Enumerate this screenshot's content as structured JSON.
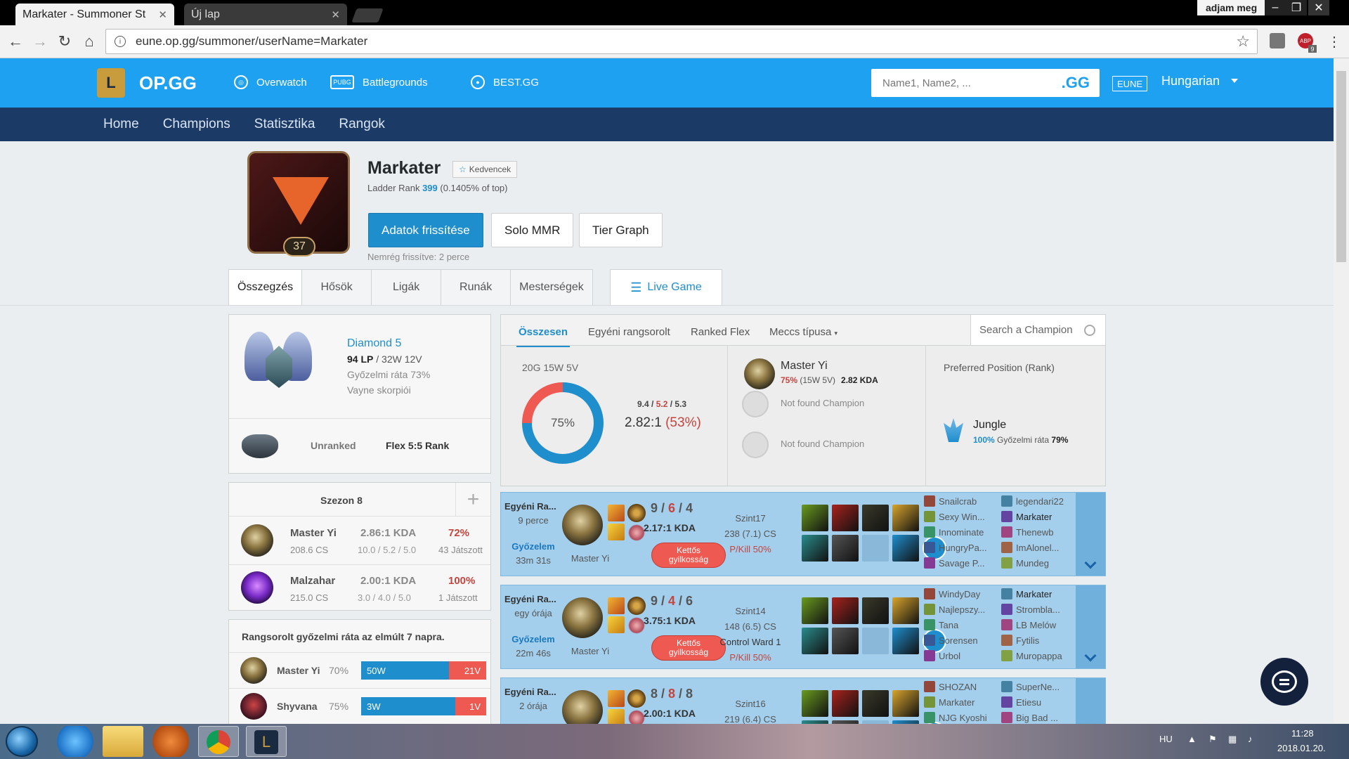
{
  "browser": {
    "tab_active": "Markater - Summoner St",
    "tab_inactive": "Új lap",
    "tab_favicon": "OP.GG",
    "user": "adjam meg",
    "url": "eune.op.gg/summoner/userName=Markater",
    "abp_label": "ABP",
    "abp_count": "9"
  },
  "header": {
    "brand": "OP.GG",
    "nav": [
      "Overwatch",
      "Battlegrounds",
      "BEST.GG"
    ],
    "search_placeholder": "Name1, Name2, ...",
    "search_suffix": ".GG",
    "region": "EUNE",
    "language": "Hungarian"
  },
  "subnav": [
    "Home",
    "Champions",
    "Statisztika",
    "Rangok"
  ],
  "profile": {
    "name": "Markater",
    "level": "37",
    "favorite": "Kedvencek",
    "ladder_prefix": "Ladder Rank ",
    "ladder_rank": "399",
    "ladder_suffix": " (0.1405% of top)",
    "btn_update": "Adatok frissítése",
    "btn_mmr": "Solo MMR",
    "btn_tier": "Tier Graph",
    "updated": "Nemrég frissítve: 2 perce"
  },
  "tabs": [
    "Összegzés",
    "Hősök",
    "Ligák",
    "Runák",
    "Mesterségek"
  ],
  "live_game": "Live Game",
  "rank": {
    "tier": "Diamond 5",
    "lp": "94 LP",
    "record": " / 32W 12V",
    "winrate": "Győzelmi ráta 73%",
    "league": "Vayne skorpiói",
    "flex_status": "Unranked",
    "flex_label": "Flex 5:5 Rank"
  },
  "season": {
    "title": "Szezon 8",
    "rows": [
      {
        "name": "Master Yi",
        "cs": "208.6 CS",
        "kda": "2.86:1 KDA",
        "kda3": "10.0 / 5.2 / 5.0",
        "pct": "72%",
        "games": "43 Játszott"
      },
      {
        "name": "Malzahar",
        "cs": "215.0 CS",
        "kda": "2.00:1 KDA",
        "kda3": "3.0 / 4.0 / 5.0",
        "pct": "100%",
        "games": "1 Játszott"
      }
    ]
  },
  "week": {
    "title": "Rangsorolt győzelmi ráta az elmúlt 7 napra.",
    "rows": [
      {
        "name": "Master Yi",
        "pct": "70%",
        "w": "50W",
        "l": "21V",
        "wfrac": 0.7
      },
      {
        "name": "Shyvana",
        "pct": "75%",
        "w": "3W",
        "l": "1V",
        "wfrac": 0.75
      }
    ]
  },
  "summary": {
    "tabs": [
      "Összesen",
      "Egyéni rangsorolt",
      "Ranked Flex",
      "Meccs típusa"
    ],
    "search": "Search a Champion",
    "games": "20G 15W 5V",
    "winrate_label": "75%",
    "winrate": 0.75,
    "k": "9.4",
    "d": "5.2",
    "a": "5.3",
    "ratio": "2.82:1",
    "ratio_pct": "(53%)",
    "top_champ": {
      "name": "Master Yi",
      "pct": "75%",
      "record": " (15W 5V)",
      "kda": "2.82 KDA"
    },
    "not_found": [
      "Not found Champion",
      "Not found Champion"
    ],
    "pref_title": "Preferred Position (Rank)",
    "position": "Jungle",
    "position_pct": "100%",
    "position_wr_label": "Győzelmi ráta",
    "position_wr": "79%"
  },
  "matches": [
    {
      "type": "Egyéni Ra...",
      "ago": "9 perce",
      "result": "Győzelem",
      "duration": "33m 31s",
      "champ": "Master Yi",
      "k": "9",
      "d": "6",
      "a": "4",
      "ratio": "2.17:1 KDA",
      "badge": [
        "Kettős",
        "gyilkosság"
      ],
      "level": "Szint17",
      "cs": "238 (7.1) CS",
      "ward": "",
      "pkill": "P/Kill 50%",
      "team1": [
        "Snailcrab",
        "Sexy Win...",
        "Innominate",
        "HungryPa...",
        "Savage P..."
      ],
      "team2": [
        "legendari22",
        "Markater",
        "Thenewb",
        "ImAlonel...",
        "Mundeg"
      ]
    },
    {
      "type": "Egyéni Ra...",
      "ago": "egy órája",
      "result": "Győzelem",
      "duration": "22m 46s",
      "champ": "Master Yi",
      "k": "9",
      "d": "4",
      "a": "6",
      "ratio": "3.75:1 KDA",
      "badge": [
        "Kettős",
        "gyilkosság"
      ],
      "level": "Szint14",
      "cs": "148 (6.5) CS",
      "ward": "Control Ward 1",
      "pkill": "P/Kill 50%",
      "team1": [
        "WindyDay",
        "Najlepszy...",
        "Tana",
        "Sorensen",
        "Urbol"
      ],
      "team2": [
        "Markater",
        "Strombla...",
        "LB Melów",
        "Fytilis",
        "Muropappa"
      ]
    },
    {
      "type": "Egyéni Ra...",
      "ago": "2 órája",
      "result": "",
      "duration": "",
      "champ": "",
      "k": "8",
      "d": "8",
      "a": "8",
      "ratio": "2.00:1 KDA",
      "badge": [
        "",
        ""
      ],
      "level": "Szint16",
      "cs": "219 (6.4) CS",
      "ward": "",
      "pkill": "",
      "team1": [
        "SHOZAN",
        "Markater",
        "NJG Kyoshi"
      ],
      "team2": [
        "SuperNe...",
        "Etiesu",
        "Big Bad ..."
      ]
    }
  ],
  "taskbar": {
    "lang": "HU",
    "time": "11:28",
    "date": "2018.01.20."
  },
  "colors": {
    "header": "#1ea1f1",
    "subnav": "#1b3a65",
    "win": "#1f8ecd",
    "loss": "#ee5a52",
    "match_bg": "#a3cfec"
  }
}
